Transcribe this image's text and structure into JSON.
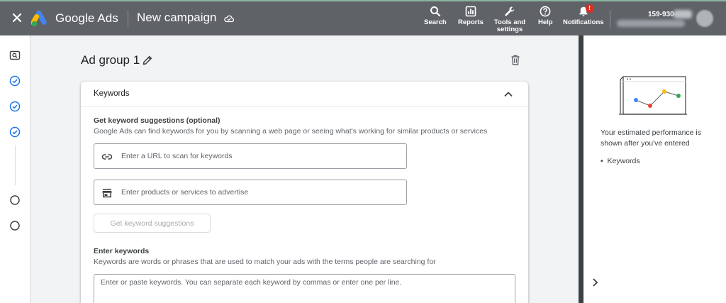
{
  "topbar": {
    "close_icon": "close-icon",
    "logo_icon": "google-ads-logo",
    "brand": "Google Ads",
    "campaign_title": "New campaign",
    "cloud_icon": "cloud-saved-icon",
    "nav": [
      {
        "label": "Search",
        "icon": "search-icon"
      },
      {
        "label": "Reports",
        "icon": "reports-icon"
      },
      {
        "label": "Tools and settings",
        "icon": "wrench-icon"
      },
      {
        "label": "Help",
        "icon": "help-icon"
      },
      {
        "label": "Notifications",
        "icon": "bell-icon",
        "badge": "!"
      }
    ],
    "account_number": "159-930-"
  },
  "rail": {
    "steps": [
      {
        "state": "current",
        "icon": "search-step-icon"
      },
      {
        "state": "complete",
        "icon": "check-circle-icon"
      },
      {
        "state": "complete",
        "icon": "check-circle-icon"
      },
      {
        "state": "complete",
        "icon": "check-circle-icon"
      },
      {
        "state": "incomplete",
        "icon": "empty-circle-icon"
      },
      {
        "state": "incomplete",
        "icon": "empty-circle-icon"
      }
    ]
  },
  "main": {
    "ad_group_title": "Ad group 1",
    "card": {
      "title": "Keywords",
      "suggest_title": "Get keyword suggestions (optional)",
      "suggest_desc": "Google Ads can find keywords for you by scanning a web page or seeing what's working for similar products or services",
      "url_placeholder": "Enter a URL to scan for keywords",
      "product_placeholder": "Enter products or services to advertise",
      "suggest_button": "Get keyword suggestions",
      "enter_title": "Enter keywords",
      "enter_desc": "Keywords are words or phrases that are used to match your ads with the terms people are searching for",
      "keywords_placeholder": "Enter or paste keywords. You can separate each keyword by commas or enter one per line."
    }
  },
  "right_panel": {
    "perf_text": "Your estimated performance is shown after you've entered",
    "bullet": "Keywords"
  },
  "colors": {
    "topbar": "#5f6368",
    "accent_blue": "#1a73e8",
    "panel_divider": "#3c4043"
  }
}
